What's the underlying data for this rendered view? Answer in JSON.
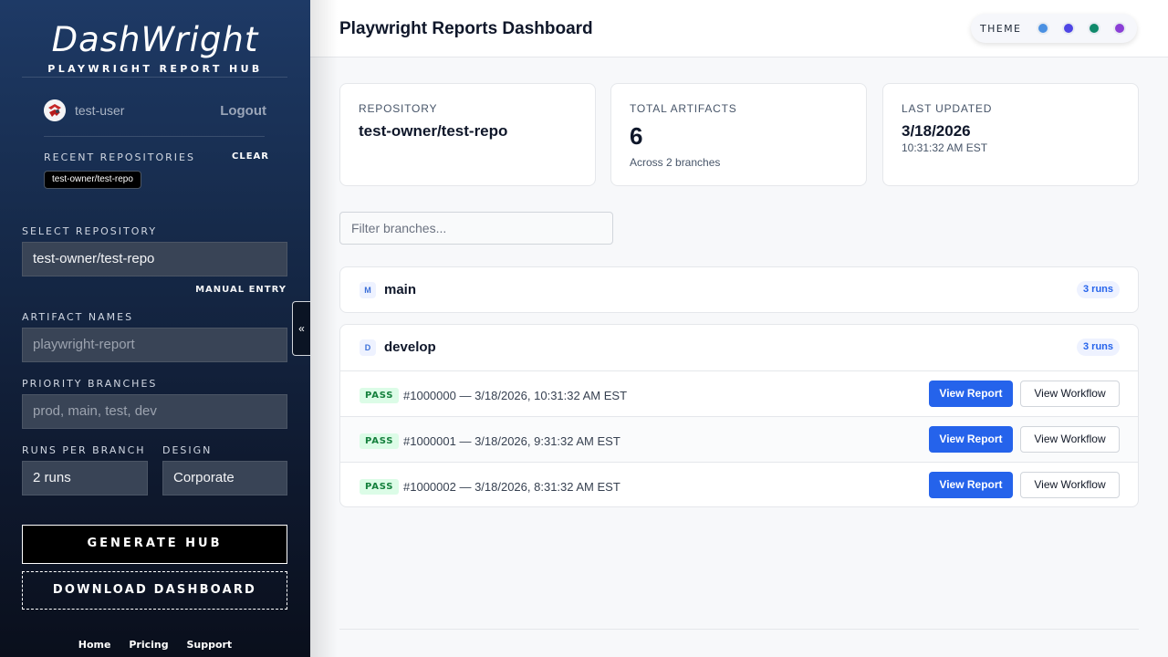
{
  "sidebar": {
    "brand_title": "DashWright",
    "brand_subtitle": "PLAYWRIGHT REPORT HUB",
    "username": "test-user",
    "logout_label": "Logout",
    "recent_label": "RECENT REPOSITORIES",
    "clear_label": "CLEAR",
    "recent_items": [
      "test-owner/test-repo"
    ],
    "select_repo_label": "SELECT REPOSITORY",
    "select_repo_value": "test-owner/test-repo",
    "manual_entry_label": "MANUAL ENTRY",
    "artifact_names_label": "ARTIFACT NAMES",
    "artifact_names_placeholder": "playwright-report",
    "priority_branches_label": "PRIORITY BRANCHES",
    "priority_branches_placeholder": "prod, main, test, dev",
    "runs_per_branch_label": "RUNS PER BRANCH",
    "runs_per_branch_value": "2 runs",
    "design_label": "DESIGN",
    "design_value": "Corporate",
    "generate_label": "GENERATE HUB",
    "download_label": "DOWNLOAD DASHBOARD",
    "collapse_icon": "«",
    "footer_links": [
      "Home",
      "Pricing",
      "Support"
    ]
  },
  "header": {
    "title": "Playwright Reports Dashboard",
    "theme_label": "THEME",
    "theme_swatches": [
      "#4a90e2",
      "#4f46e5",
      "#10896b",
      "#8b3fd6"
    ]
  },
  "cards": {
    "repository": {
      "label": "REPOSITORY",
      "value": "test-owner/test-repo"
    },
    "artifacts": {
      "label": "TOTAL ARTIFACTS",
      "value": "6",
      "sub": "Across 2 branches"
    },
    "updated": {
      "label": "LAST UPDATED",
      "value": "3/18/2026",
      "sub": "10:31:32 AM EST"
    }
  },
  "filter": {
    "placeholder": "Filter branches..."
  },
  "branches": [
    {
      "initial": "M",
      "name": "main",
      "runs": "3 runs"
    },
    {
      "initial": "D",
      "name": "develop",
      "runs": "3 runs",
      "run_rows": [
        {
          "status": "PASS",
          "text": "#1000000 — 3/18/2026, 10:31:32 AM EST"
        },
        {
          "status": "PASS",
          "text": "#1000001 — 3/18/2026, 9:31:32 AM EST"
        },
        {
          "status": "PASS",
          "text": "#1000002 — 3/18/2026, 8:31:32 AM EST"
        }
      ]
    }
  ],
  "actions": {
    "view_report": "View Report",
    "view_workflow": "View Workflow"
  }
}
